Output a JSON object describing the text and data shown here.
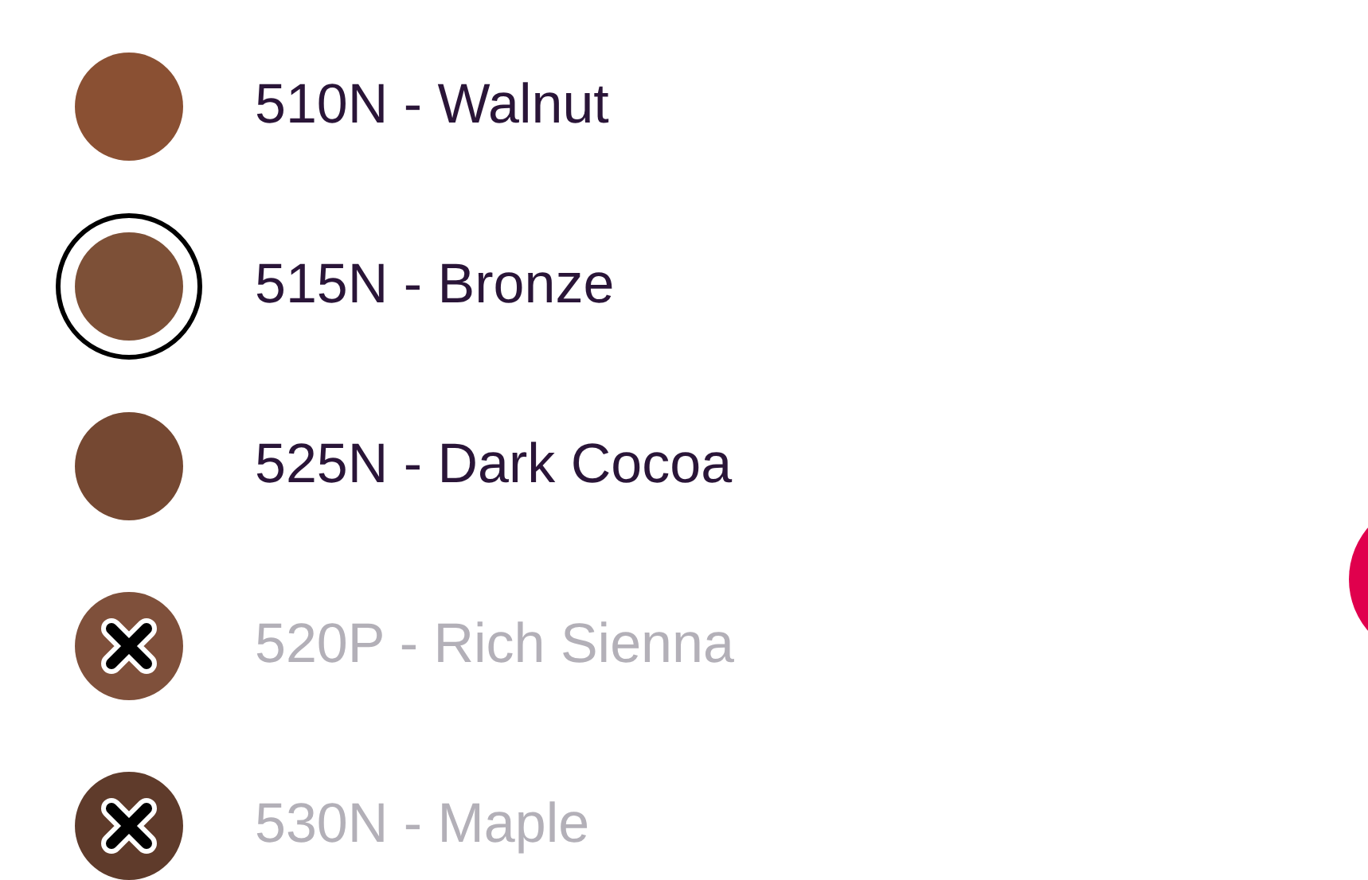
{
  "swatches": [
    {
      "label": "510N - Walnut",
      "color": "#8a5033",
      "selected": false,
      "available": true
    },
    {
      "label": "515N - Bronze",
      "color": "#7d5037",
      "selected": true,
      "available": true
    },
    {
      "label": "525N - Dark Cocoa",
      "color": "#754832",
      "selected": false,
      "available": true
    },
    {
      "label": "520P - Rich Sienna",
      "color": "#7f503b",
      "selected": false,
      "available": false
    },
    {
      "label": "530N - Maple",
      "color": "#5f3b2b",
      "selected": false,
      "available": false
    }
  ]
}
